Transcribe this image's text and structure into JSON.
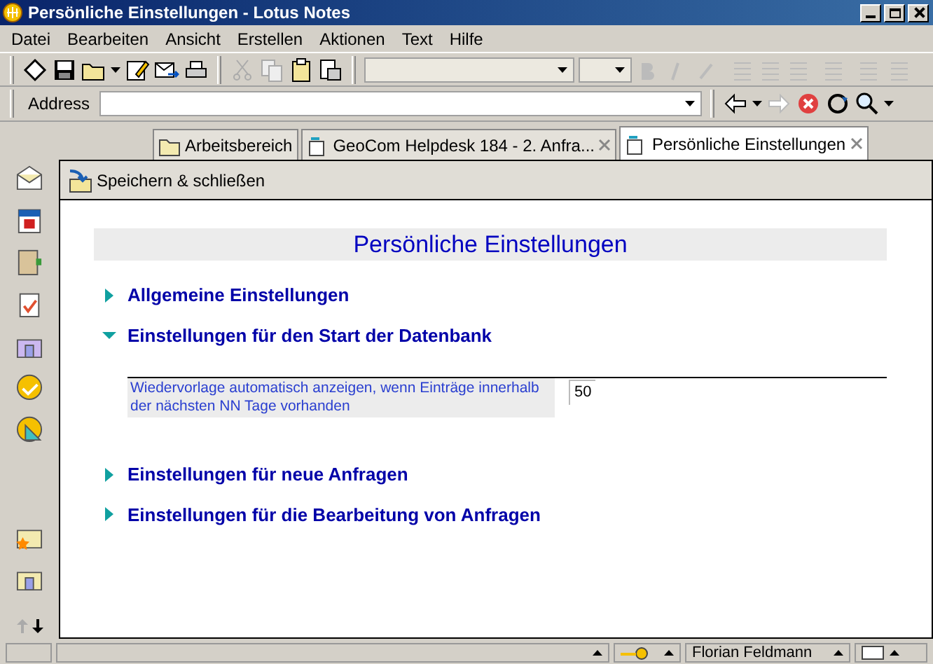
{
  "window": {
    "title": "Persönliche Einstellungen - Lotus Notes"
  },
  "menu": [
    "Datei",
    "Bearbeiten",
    "Ansicht",
    "Erstellen",
    "Aktionen",
    "Text",
    "Hilfe"
  ],
  "address": {
    "label": "Address"
  },
  "tabs": [
    {
      "label": "Arbeitsbereich",
      "selected": false,
      "closable": false
    },
    {
      "label": "GeoCom Helpdesk 184 - 2. Anfra...",
      "selected": false,
      "closable": true
    },
    {
      "label": "Persönliche Einstellungen",
      "selected": true,
      "closable": true
    }
  ],
  "action_bar": {
    "button": "Speichern & schließen"
  },
  "form": {
    "heading": "Persönliche Einstellungen",
    "sections": [
      {
        "title": "Allgemeine Einstellungen",
        "expanded": false
      },
      {
        "title": "Einstellungen für den Start der Datenbank",
        "expanded": true,
        "field": {
          "label": "Wiedervorlage automatisch anzeigen, wenn Einträge innerhalb der nächsten NN Tage vorhanden",
          "value": "50"
        }
      },
      {
        "title": "Einstellungen für neue Anfragen",
        "expanded": false
      },
      {
        "title": "Einstellungen für die Bearbeitung von Anfragen",
        "expanded": false
      }
    ]
  },
  "status_bar": {
    "user": "Florian Feldmann"
  }
}
